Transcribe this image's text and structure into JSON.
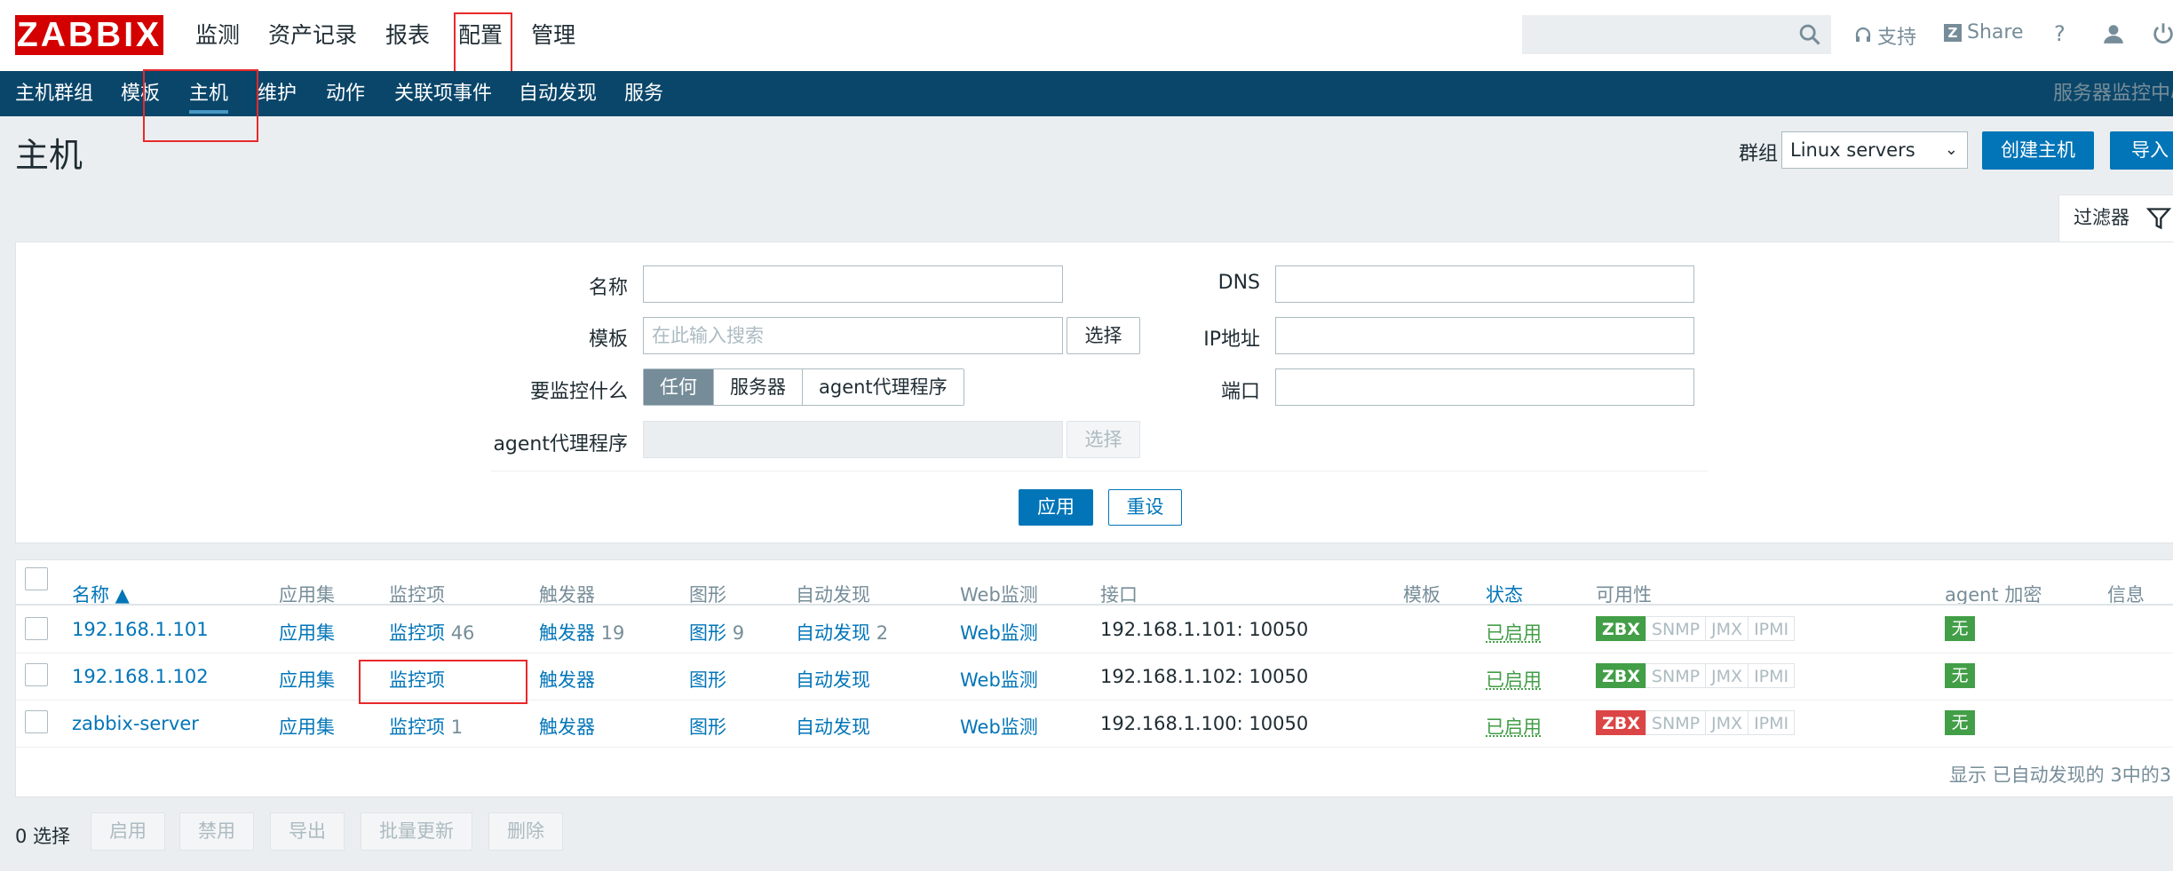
{
  "top": {
    "logo": "ZABBIX",
    "menu": [
      "监测",
      "资产记录",
      "报表",
      "配置",
      "管理"
    ],
    "support": "支持",
    "share": "Share",
    "help": "?"
  },
  "subnav": {
    "items": [
      "主机群组",
      "模板",
      "主机",
      "维护",
      "动作",
      "关联项事件",
      "自动发现",
      "服务"
    ],
    "right": "服务器监控中心"
  },
  "page": {
    "title": "主机",
    "group_label": "群组",
    "group_value": "Linux servers",
    "create_btn": "创建主机",
    "import_btn": "导入"
  },
  "filter": {
    "tab": "过滤器",
    "name_label": "名称",
    "template_label": "模板",
    "template_placeholder": "在此输入搜索",
    "select_btn": "选择",
    "monitor_label": "要监控什么",
    "monitor_options": [
      "任何",
      "服务器",
      "agent代理程序"
    ],
    "proxy_label": "agent代理程序",
    "proxy_select_btn": "选择",
    "dns_label": "DNS",
    "ip_label": "IP地址",
    "port_label": "端口",
    "apply": "应用",
    "reset": "重设"
  },
  "table": {
    "headers": {
      "name": "名称 ▲",
      "apps": "应用集",
      "items": "监控项",
      "triggers": "触发器",
      "graphs": "图形",
      "discovery": "自动发现",
      "web": "Web监测",
      "interface": "接口",
      "templates": "模板",
      "status": "状态",
      "availability": "可用性",
      "encryption": "agent 加密",
      "info": "信息"
    },
    "rows": [
      {
        "name": "192.168.1.101",
        "apps": "应用集",
        "items": "监控项",
        "items_count": "46",
        "triggers": "触发器",
        "triggers_count": "19",
        "graphs": "图形",
        "graphs_count": "9",
        "discovery": "自动发现",
        "discovery_count": "2",
        "web": "Web监测",
        "interface": "192.168.1.101: 10050",
        "status": "已启用",
        "zbx": "ZBX",
        "zbx_color": "#429e47",
        "snmp": "SNMP",
        "jmx": "JMX",
        "ipmi": "IPMI",
        "enc": "无"
      },
      {
        "name": "192.168.1.102",
        "apps": "应用集",
        "items": "监控项",
        "items_count": "",
        "triggers": "触发器",
        "triggers_count": "",
        "graphs": "图形",
        "graphs_count": "",
        "discovery": "自动发现",
        "discovery_count": "",
        "web": "Web监测",
        "interface": "192.168.1.102: 10050",
        "status": "已启用",
        "zbx": "ZBX",
        "zbx_color": "#429e47",
        "snmp": "SNMP",
        "jmx": "JMX",
        "ipmi": "IPMI",
        "enc": "无"
      },
      {
        "name": "zabbix-server",
        "apps": "应用集",
        "items": "监控项",
        "items_count": "1",
        "triggers": "触发器",
        "triggers_count": "",
        "graphs": "图形",
        "graphs_count": "",
        "discovery": "自动发现",
        "discovery_count": "",
        "web": "Web监测",
        "interface": "192.168.1.100: 10050",
        "status": "已启用",
        "zbx": "ZBX",
        "zbx_color": "#dc4545",
        "snmp": "SNMP",
        "jmx": "JMX",
        "ipmi": "IPMI",
        "enc": "无"
      }
    ],
    "footer": "显示 已自动发现的 3中的3"
  },
  "bottom": {
    "count": "0 选择",
    "buttons": [
      "启用",
      "禁用",
      "导出",
      "批量更新",
      "删除"
    ]
  }
}
